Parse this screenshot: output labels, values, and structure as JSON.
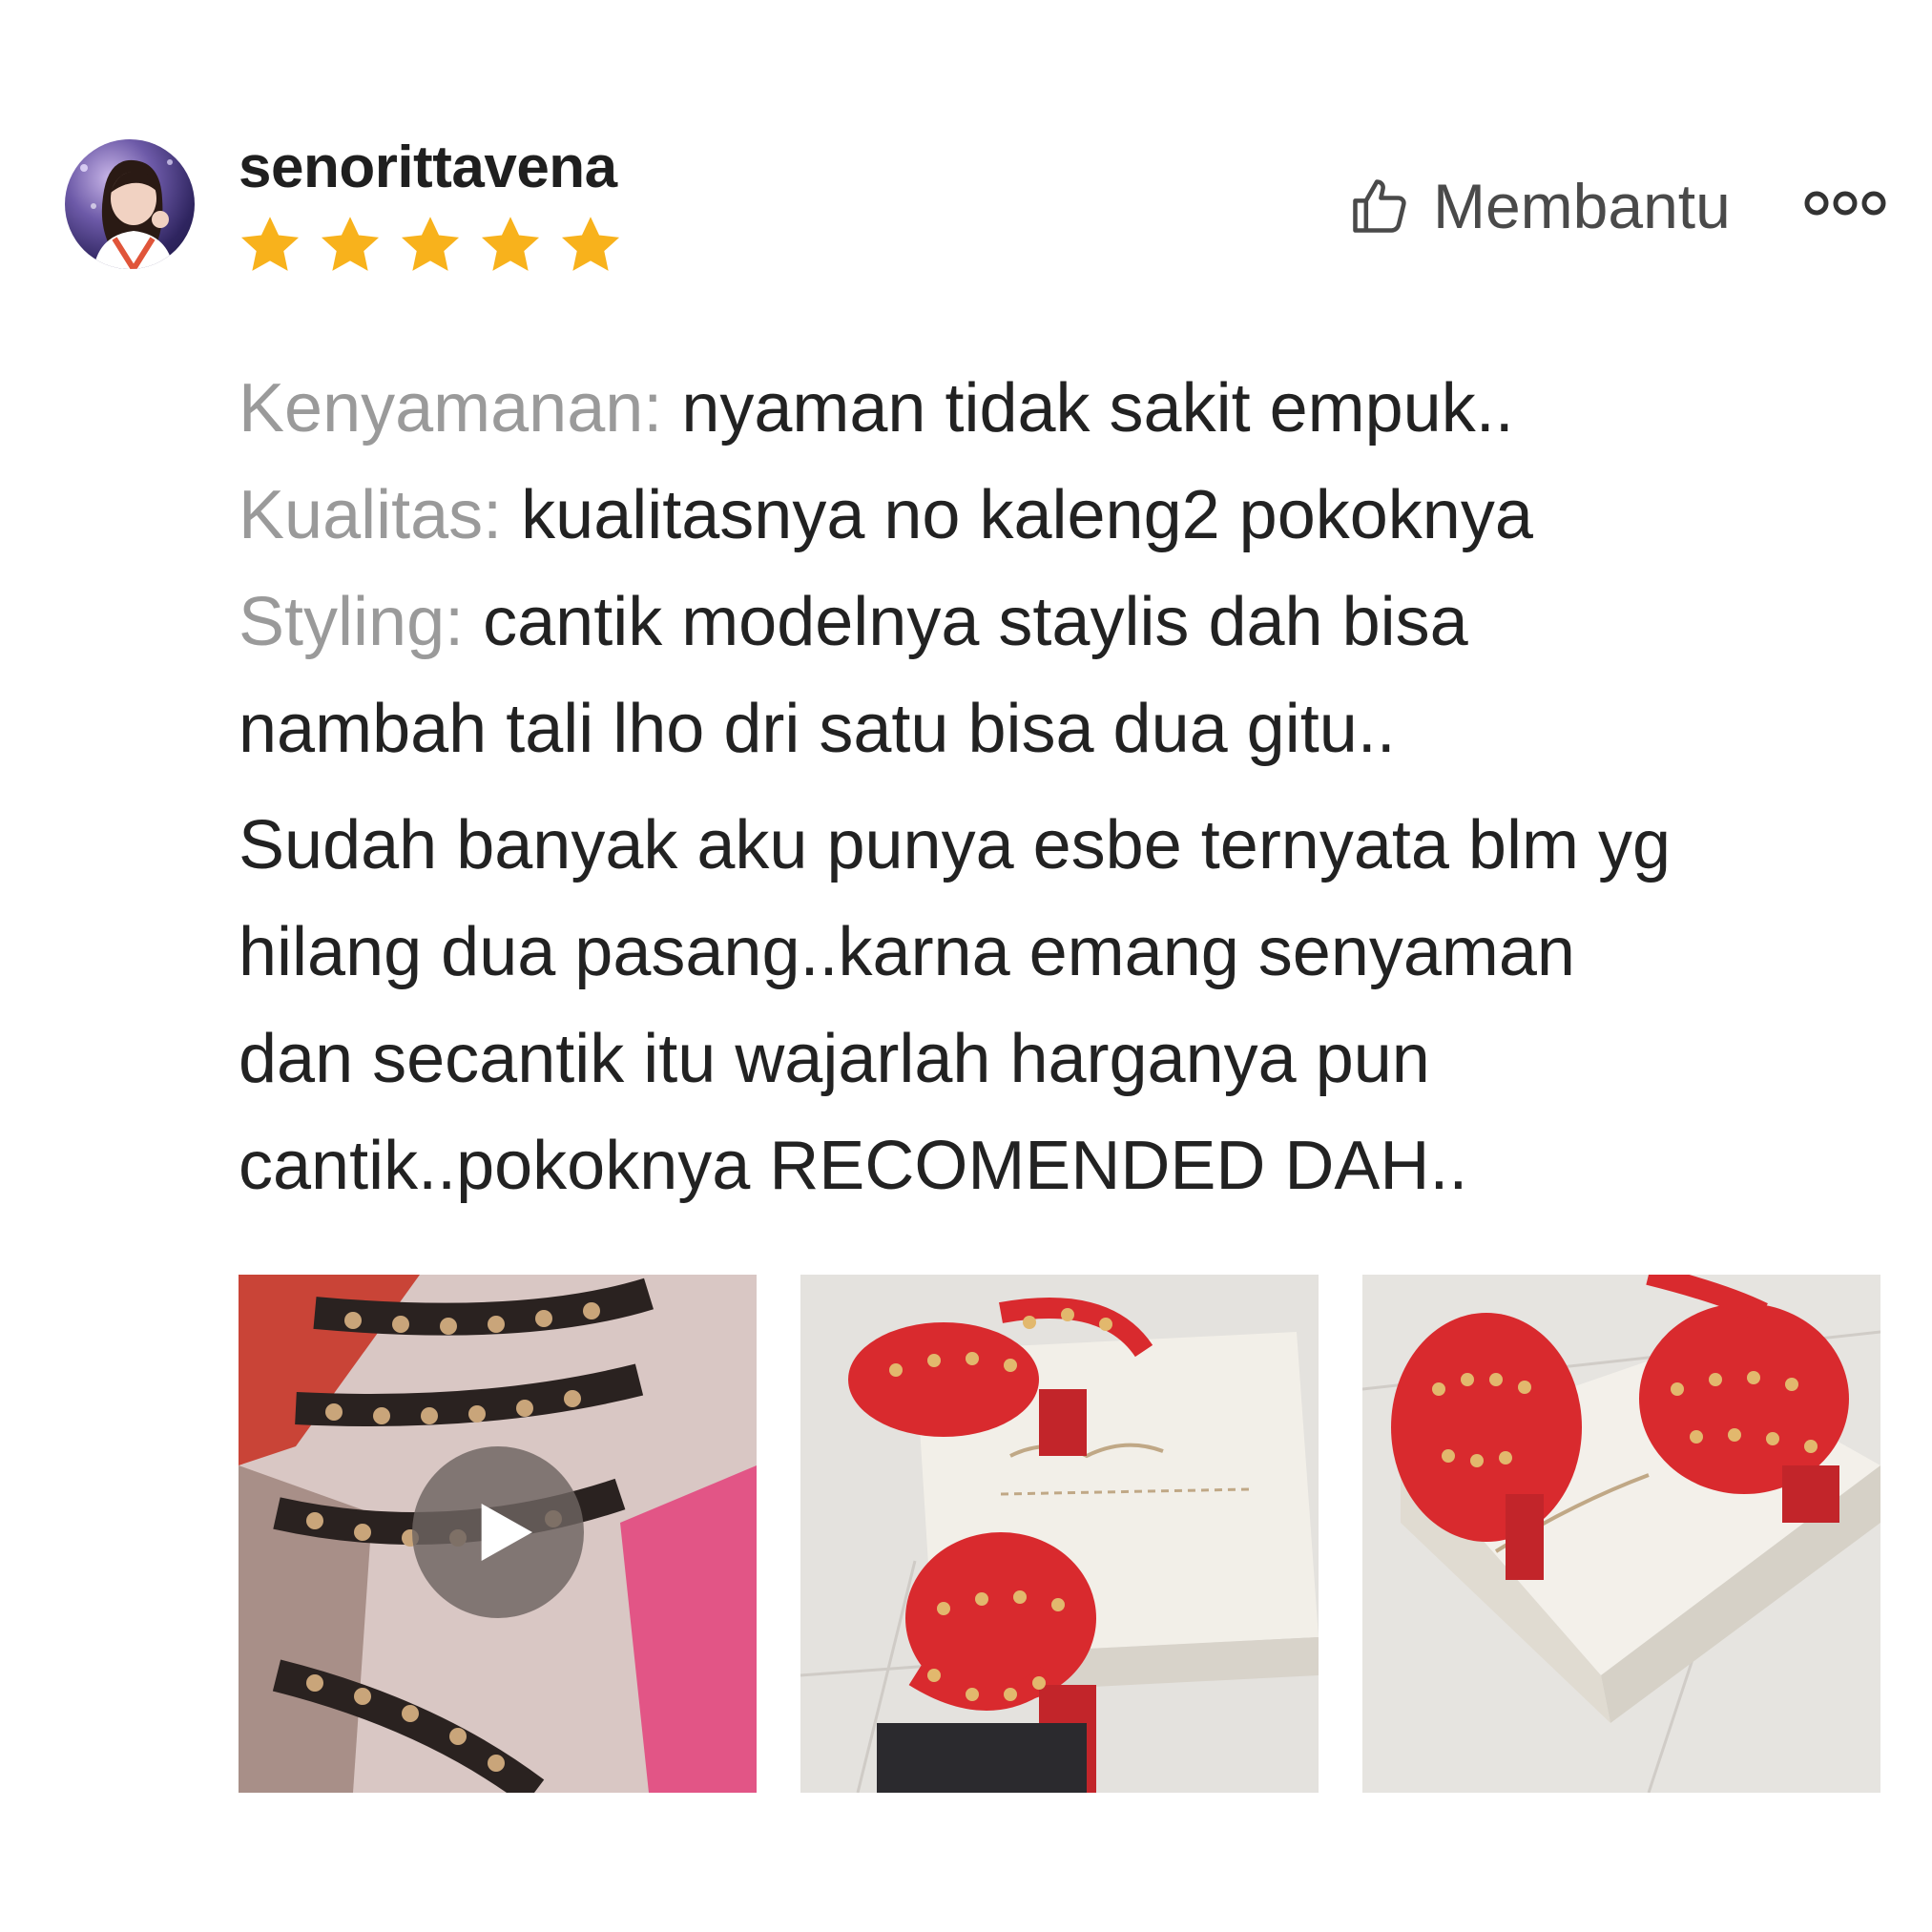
{
  "reviewer": {
    "username": "senorittavena",
    "rating": 5
  },
  "actions": {
    "helpful_label": "Membantu",
    "helpful_icon": "thumbs-up-icon",
    "more_icon": "more-dots-icon"
  },
  "review": {
    "comfort_label": "Kenyamanan:",
    "comfort_text": " nyaman tidak sakit empuk..",
    "quality_label": "Kualitas:",
    "quality_text": " kualitasnya no kaleng2 pokoknya",
    "styling_label": "Styling:",
    "styling_text": " cantik modelnya staylis dah bisa",
    "styling_text_2": "nambah tali lho dri satu bisa dua gitu..",
    "body_lines": [
      "Sudah banyak aku punya esbe ternyata blm yg",
      "hilang dua pasang..karna emang senyaman",
      "dan secantik itu wajarlah harganya pun",
      "cantik..pokoknya RECOMENDED  DAH.."
    ]
  },
  "colors": {
    "star": "#f8b21c",
    "label_gray": "#9a9a9a",
    "text": "#222222"
  }
}
